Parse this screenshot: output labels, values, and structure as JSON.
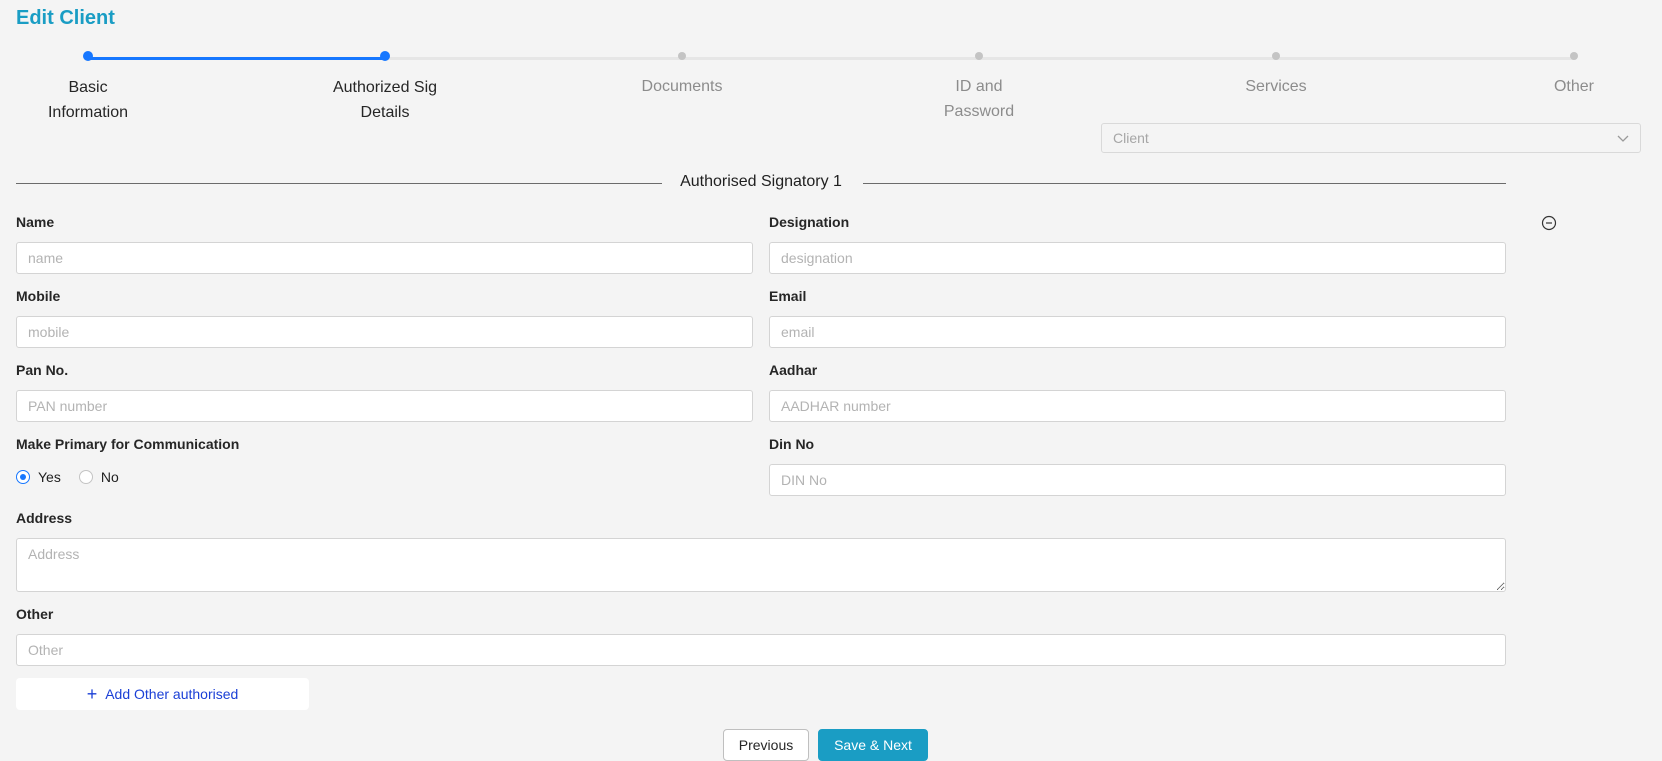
{
  "page": {
    "title": "Edit Client"
  },
  "stepper": {
    "progress": 0.2,
    "steps": [
      {
        "label": "Basic Information",
        "state": "done"
      },
      {
        "label": "Authorized Sig Details",
        "state": "active"
      },
      {
        "label": "Documents",
        "state": "pending"
      },
      {
        "label": "ID and Password",
        "state": "pending"
      },
      {
        "label": "Services",
        "state": "pending"
      },
      {
        "label": "Other",
        "state": "pending"
      }
    ]
  },
  "client_select": {
    "placeholder": "Client"
  },
  "section": {
    "title": "Authorised Signatory 1"
  },
  "form": {
    "name": {
      "label": "Name",
      "placeholder": "name",
      "value": ""
    },
    "designation": {
      "label": "Designation",
      "placeholder": "designation",
      "value": ""
    },
    "mobile": {
      "label": "Mobile",
      "placeholder": "mobile",
      "value": ""
    },
    "email": {
      "label": "Email",
      "placeholder": "email",
      "value": ""
    },
    "pan": {
      "label": "Pan No.",
      "placeholder": "PAN number",
      "value": ""
    },
    "aadhar": {
      "label": "Aadhar",
      "placeholder": "AADHAR number",
      "value": ""
    },
    "primary": {
      "label": "Make Primary for Communication",
      "options": [
        "Yes",
        "No"
      ],
      "selected": "Yes"
    },
    "din": {
      "label": "Din No",
      "placeholder": "DIN No",
      "value": ""
    },
    "address": {
      "label": "Address",
      "placeholder": "Address",
      "value": ""
    },
    "other": {
      "label": "Other",
      "placeholder": "Other",
      "value": ""
    }
  },
  "actions": {
    "add_label": "Add Other authorised",
    "previous_label": "Previous",
    "save_next_label": "Save & Next"
  },
  "colors": {
    "brand": "#1a9dc4",
    "accent": "#1677ff",
    "link": "#1a3fd6"
  }
}
